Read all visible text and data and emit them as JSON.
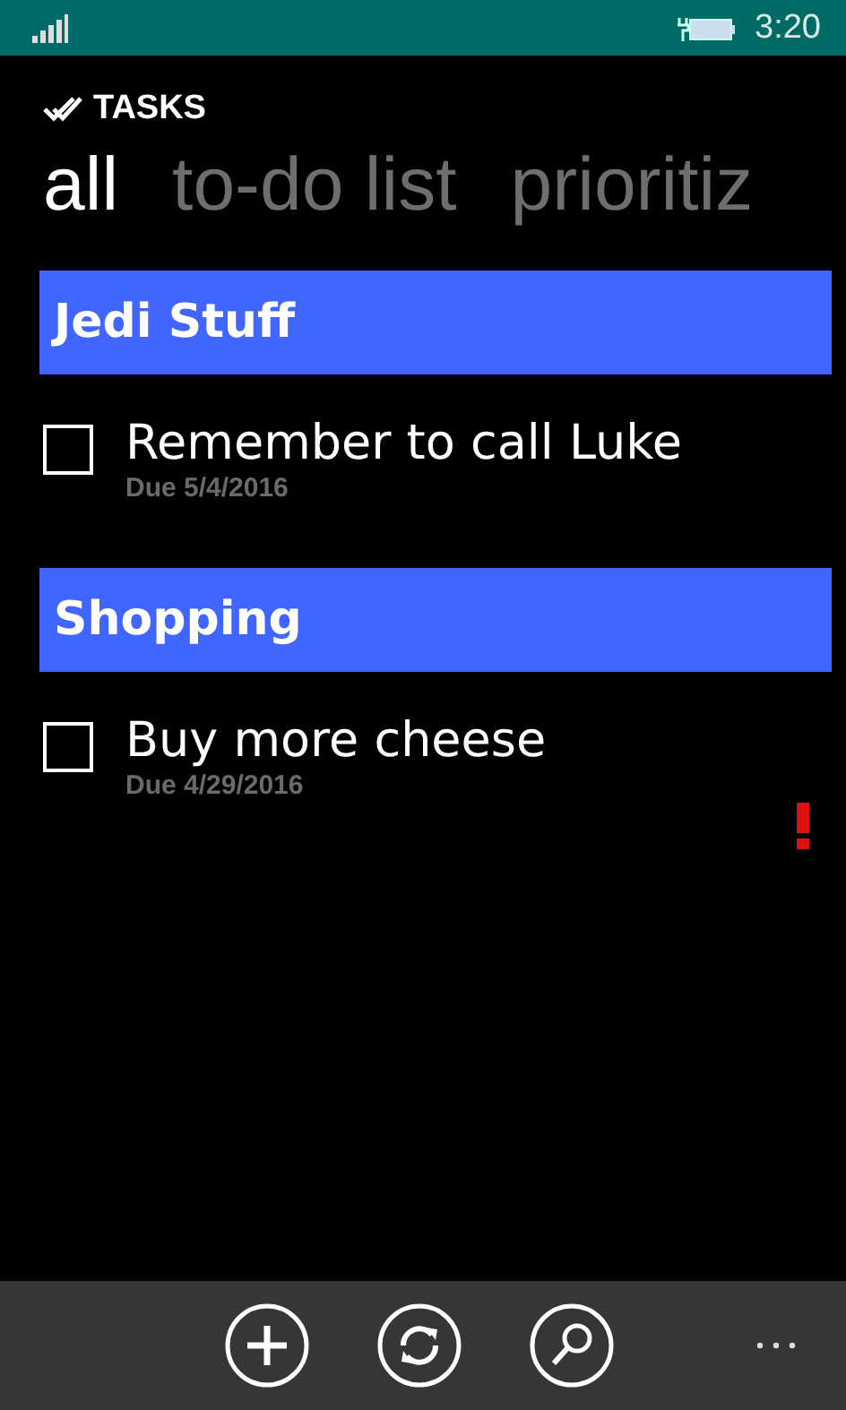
{
  "status_bar": {
    "time": "3:20"
  },
  "app_title": "TASKS",
  "tabs": [
    {
      "label": "all",
      "selected": true
    },
    {
      "label": "to-do list",
      "selected": false
    },
    {
      "label": "prioritiz",
      "selected": false
    }
  ],
  "groups": [
    {
      "name": "Jedi Stuff",
      "tasks": [
        {
          "title": "Remember to call Luke",
          "due": "Due 5/4/2016",
          "checked": false,
          "high_priority": false
        }
      ]
    },
    {
      "name": "Shopping",
      "tasks": [
        {
          "title": "Buy more cheese",
          "due": "Due 4/29/2016",
          "checked": false,
          "high_priority": true
        }
      ]
    }
  ]
}
